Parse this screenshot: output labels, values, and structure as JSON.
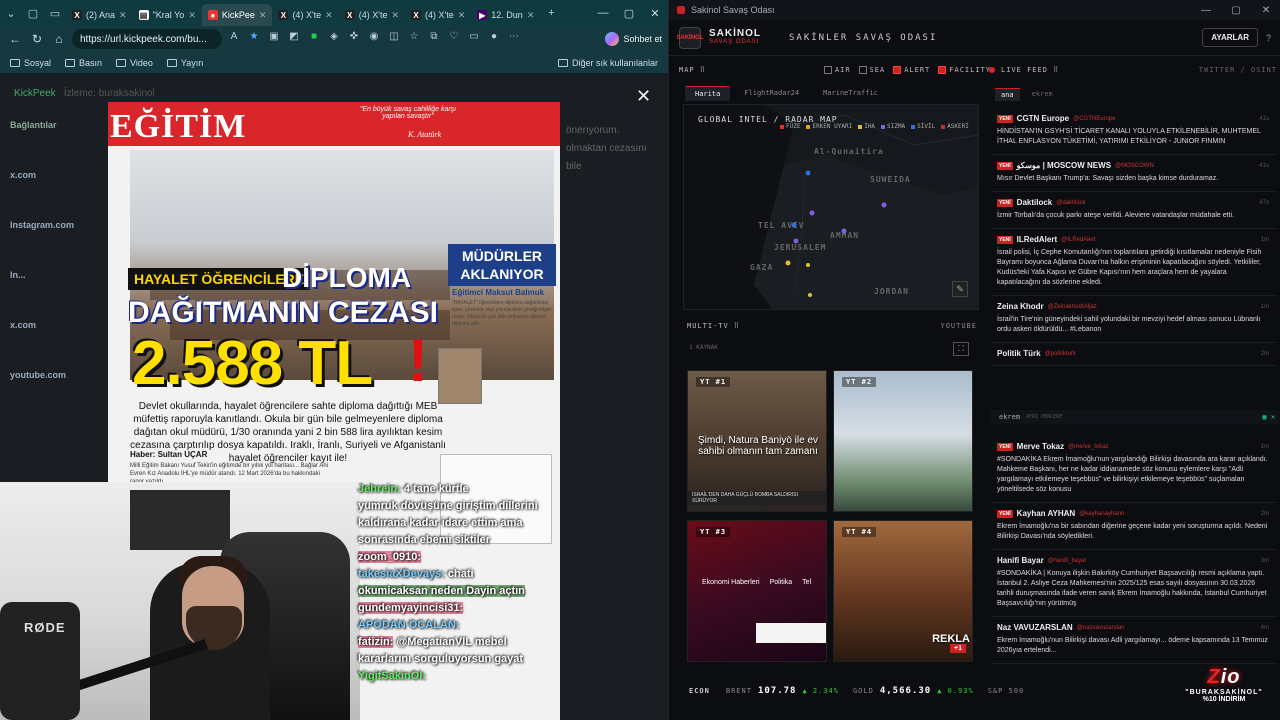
{
  "browser": {
    "tabs": [
      {
        "label": "(2) Ana",
        "icon": "x-logo"
      },
      {
        "label": "\"Kral Yo",
        "icon": "news"
      },
      {
        "label": "KickPee",
        "icon": "kickpeek",
        "active": true
      },
      {
        "label": "(4) X'te",
        "icon": "x-logo"
      },
      {
        "label": "(4) X'te",
        "icon": "x-logo"
      },
      {
        "label": "(4) X'te",
        "icon": "x-logo"
      },
      {
        "label": "12. Dun",
        "icon": "media"
      }
    ],
    "url": "https://url.kickpeek.com/bu...",
    "copilot_label": "Sohbet et",
    "bookmarks": [
      "Sosyal",
      "Basın",
      "Video",
      "Yayın"
    ],
    "bookmarks_other": "Diğer sık kullanılanlar"
  },
  "kickpeek": {
    "brand": "KickPeek",
    "watching": "İzleme: buraksakinol",
    "sidebar_title": "Bağlantılar",
    "sidebar_items": [
      "x.com",
      "Instagram.com",
      "In...",
      "x.com",
      "youtube.com"
    ],
    "bg_snippet": "önerıyorum. olmaktan cezasını bile"
  },
  "poster": {
    "title": "EĞİTİM",
    "quote": "\"En büyük savaş cahilliğe karşı yapılan savaştır\"",
    "signature": "K. Atatürk",
    "kicker": "HAYALET ÖĞRENCİLERE",
    "headline_word": "DİPLOMA",
    "headline_line2": "DAĞITMANIN CEZASI",
    "amount": "2.588 TL",
    "exclaim": "!",
    "side_title": "MÜDÜRLER AKLANIYOR",
    "side_author": "Eğitimci Maksut Balmuk",
    "side_text": "\"HAYALET\" öğrencilere diploma dağıtılması işine, yüzlerce okul yöneticisinin girdiği bilgisi ulaştı. Okula bir gün bile gelmeyen öğrenci diploma aldı...",
    "body": "Devlet okullarında, hayalet öğrencilere sahte diploma dağıttığı MEB müfettiş raporuyla kanıtlandı. Okula bir gün bile gelmeyenlere diploma dağıtan okul müdürü, 1/30 oranında yani 2 bin 588 lira ayılıktan kesim cezasına çarptırılıp dosya kapatıldı. Iraklı, İranlı, Suriyeli ve Afganistanlı hayalet öğrenciler kayıt ile!",
    "byline": "Haber: Sultan UÇAR",
    "col_text": "Milli Eğitim Bakanı Yusuf Tekin'in eğitimde bir yıllık yol haritası... Bağlar Ahi Evren Kız Anadolu İHL'ye müdür atandı. 12 Mart 2026'da bu hakkındaki rapor yazıldı."
  },
  "chat": [
    {
      "user": "Jehrein:",
      "text": "4 tane kürtle",
      "cls": "u-g"
    },
    {
      "user": "",
      "text": "yumruk dövüşüne giriştim dillerini",
      "cls": ""
    },
    {
      "user": "",
      "text": "kaldırana kadar idare ettim ama",
      "cls": ""
    },
    {
      "user": "",
      "text": "sonrasında ebemi siktiler",
      "cls": ""
    },
    {
      "user": "zoom_0910:",
      "text": "",
      "cls": "u-c"
    },
    {
      "user": "takesiaXDevays:",
      "text": "chati",
      "cls": "u-b"
    },
    {
      "user": "",
      "text": "okumicaksan neden Dayin açtın",
      "cls": "hl"
    },
    {
      "user": "gundemyayincisi31:",
      "text": "",
      "cls": "u-c"
    },
    {
      "user": "APODAN OCALAN:",
      "text": "",
      "cls": "u-b"
    },
    {
      "user": "fatizin:",
      "text": "@MegatianVIL mebel",
      "cls": "u-c"
    },
    {
      "user": "",
      "text": "kararlarını sorguluyorsun gayat",
      "cls": ""
    },
    {
      "user": "YigitSakinOl:",
      "text": "",
      "cls": "u-g"
    }
  ],
  "webcam": {
    "mic_brand": "RØDE"
  },
  "dashboard": {
    "window_title": "Sakinol Savaş Odası",
    "brand_line1": "SAKİNOL",
    "brand_line2": "SAVAŞ ODASI",
    "brand_box": "SAKİNOL",
    "page_title": "SAKİNLER SAVAŞ ODASI",
    "settings_label": "AYARLAR",
    "help_label": "?",
    "map": {
      "heading": "MAP ⠿",
      "filters": [
        {
          "label": "AIR",
          "on": false
        },
        {
          "label": "SEA",
          "on": false
        },
        {
          "label": "ALERT",
          "on": true
        },
        {
          "label": "FACILITY",
          "on": true
        }
      ],
      "tabs": [
        "Harita",
        "FlightRadar24",
        "MarineTraffic"
      ],
      "overlay_title": "GLOBAL INTEL / RADAR MAP",
      "legend": [
        {
          "label": "FÜZE",
          "color": "#e03030"
        },
        {
          "label": "ERKEN UYARI",
          "color": "#e0a020"
        },
        {
          "label": "İHA",
          "color": "#e0c030"
        },
        {
          "label": "SIZMA",
          "color": "#8060e0"
        },
        {
          "label": "SİVİL",
          "color": "#3070e0"
        },
        {
          "label": "ASKERİ",
          "color": "#c03030"
        }
      ],
      "places": [
        {
          "name": "Al-Qunaitira",
          "cls": "p1"
        },
        {
          "name": "SUWEIDA",
          "cls": "p2"
        },
        {
          "name": "TEL AVIV",
          "cls": "p3"
        },
        {
          "name": "AMMAN",
          "cls": "p4"
        },
        {
          "name": "JERUSALEM",
          "cls": "p5"
        },
        {
          "name": "GAZA",
          "cls": "p6"
        },
        {
          "name": "JORDAN",
          "cls": "p7"
        }
      ],
      "edit_icon": "✎"
    },
    "multitv": {
      "heading": "MULTI-TV ⠿",
      "source": "YOUTUBE",
      "sub": "1 KAYNAK",
      "tiles": [
        {
          "label": "YT #1",
          "caption": "Şimdi, Natura Baniyö ile ev sahibi olmanın tam zamanı",
          "ticker": "İSRAİL'DEN DAHA GÜÇLÜ BOMBA SALDIRISI SÜRÜYOR"
        },
        {
          "label": "YT #2"
        },
        {
          "label": "YT #3",
          "bar": [
            "Ekonomi Haberleri",
            "Politika",
            "Tel"
          ]
        },
        {
          "label": "YT #4",
          "reklam": "REKLA",
          "plus": "+1"
        }
      ]
    },
    "econ": {
      "heading": "ECON",
      "items": [
        {
          "name": "BRENT",
          "value": "107.78",
          "change": "▲ 2.34%"
        },
        {
          "name": "GOLD",
          "value": "4,566.30",
          "change": "▲ 0.93%"
        },
        {
          "name": "S&P 500",
          "value": "",
          "change": ""
        }
      ]
    },
    "feed": {
      "heading": "LIVE FEED ⠿",
      "source": "TWITTER / OSINT",
      "tabs": [
        "ana",
        "ekrem"
      ],
      "new_badge": "YENİ",
      "posts": [
        {
          "name": "CGTN Europe",
          "handle": "@CGTNEurope",
          "time": "41s",
          "new": true,
          "text": "HİNDİSTAN'IN GSYH'Sİ TİCARET KANALI YOLUYLA ETKİLENEBİLİR, MUHTEMEL İTHAL ENFLASYON TÜKETİMİ, YATIRIMI ETKİLİYOR - JUNIOR FINMIN"
        },
        {
          "name": "موسكو | MOSCOW NEWS",
          "handle": "@MOSCOWN",
          "time": "41s",
          "new": true,
          "text": "Mısır Devlet Başkanı Trump'a: Savaşı sizden başka kimse durduramaz."
        },
        {
          "name": "Daktilock",
          "handle": "@daktilock",
          "time": "47s",
          "new": true,
          "text": "İzmir Torbalı'da çocuk parkı ateşe verildi. Aleviere vatandaşlar müdahale etti."
        },
        {
          "name": "ILRedAlert",
          "handle": "@ILRedAlert",
          "time": "1m",
          "new": true,
          "text": "İsrail polisi, İç Cephe Komutanlığı'nın toplantılara getirdiği kısıtlamalar nedeniyle Fisih Bayramı boyunca Ağlama Duvarı'na halkın erişiminin kapatılacağını söyledi. Yetkililer, Kudüs'teki Yafa Kapısı ve Gübre Kapısı'nın hem araçlara hem de yayalara kapatılacağını da sözlerine ekledi."
        },
        {
          "name": "Zeina Khodr",
          "handle": "@ZeinakhodrAljaz",
          "time": "1m",
          "new": false,
          "text": "İsrail'in Tire'nin güneyindeki sahil yolundaki bir mevziyi hedef alması sonucu Lübnanlı ordu askeri öldürüldü... #Lebanon"
        },
        {
          "name": "Politik Türk",
          "handle": "@politikturk",
          "time": "2m",
          "new": false,
          "text": ""
        }
      ]
    },
    "feed2": {
      "tab": "ekrem",
      "sub": "AYRI PENCERE",
      "icons": "▦ ✕",
      "posts": [
        {
          "name": "Merve Tokaz",
          "handle": "@merve_tokaz",
          "time": "1m",
          "new": true,
          "text": "#SONDAKİKA Ekrem İmamoğlu'nun yargılandığı Bilirkişi davasında ara karar açıklandı. Mahkeme Başkanı, her ne kadar iddianamede söz konusu eylemlere karşı \"Adli yargılamayı etkilemeye teşebbüs\" ve bilirkişiyi etkilemeye teşebbüs\" suçlamaları yöneltilsede söz konusu"
        },
        {
          "name": "Kayhan AYHAN",
          "handle": "@kayhanayhann",
          "time": "2m",
          "new": true,
          "text": "Ekrem İmamoğlu'na bir sabından diğerine geçene kadar yeni soruşturma açıldı. Nedeni Bilirkişi Davası'nda söyledikleri."
        },
        {
          "name": "Hanifi Bayar",
          "handle": "@hanifi_bayar",
          "time": "3m",
          "new": false,
          "text": "#SONDAKİKA | Konuya ilişkin Bakırköy Cumhuriyet Başsavcılığı resmi açıklama yaptı. İstanbul 2. Asliye Ceza Mahkemesi'nin 2025/125 esas sayılı dosyasının 30.03.2026 tarihli duruşmasında ifade veren sanık Ekrem İmamoğlu hakkında, İstanbul Cumhuriyet Başsavcılığı'nın yürütmüş"
        },
        {
          "name": "Naz VAVUZARSLAN",
          "handle": "@nazvavuzarslan",
          "time": "4m",
          "new": false,
          "text": "Ekrem İmamoğlu'nun Bilirkişi davası Adli yargılamayı... ödeme kapsamında 13 Temmuz 2026yıa ertelendi..."
        }
      ]
    }
  },
  "promo": {
    "logo_a": "Z",
    "logo_b": "io",
    "code": "\"BURAKSAKİNOL\"",
    "discount": "%10 İNDİRİM"
  },
  "colors": {
    "accent": "#cc2222",
    "browser_chrome": "#0e3a40",
    "poster_red": "#d9262b"
  }
}
